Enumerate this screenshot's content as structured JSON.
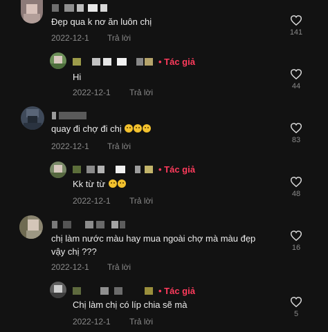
{
  "author_label": "• Tác giả",
  "reply_label": "Trả lời",
  "comments": [
    {
      "text": "Đẹp qua k nơ ăn luôn chị",
      "date": "2022-12-1",
      "likes": "141"
    },
    {
      "text": "Hi",
      "date": "2022-12-1",
      "likes": "44"
    },
    {
      "text": "quay đi chợ đi chị",
      "date": "2022-12-1",
      "likes": "83"
    },
    {
      "text": "Kk từ từ",
      "date": "2022-12-1",
      "likes": "48"
    },
    {
      "text_line1": "chị làm nước màu hay mua ngoài chợ mà màu đẹp",
      "text_line2": "vậy chị ???",
      "date": "2022-12-1",
      "likes": "16"
    },
    {
      "text": "Chị làm chị có líp chia sẽ mà",
      "date": "2022-12-1",
      "likes": "5"
    }
  ],
  "icons": {
    "like": "heart-outline-icon",
    "emoji_pleading": "pleading-face-icon",
    "emoji_laugh": "laughing-tears-icon"
  },
  "colors": {
    "background": "#121212",
    "author_tag": "#ff3b5c",
    "meta": "#8a8a8a",
    "text": "#ececec"
  }
}
